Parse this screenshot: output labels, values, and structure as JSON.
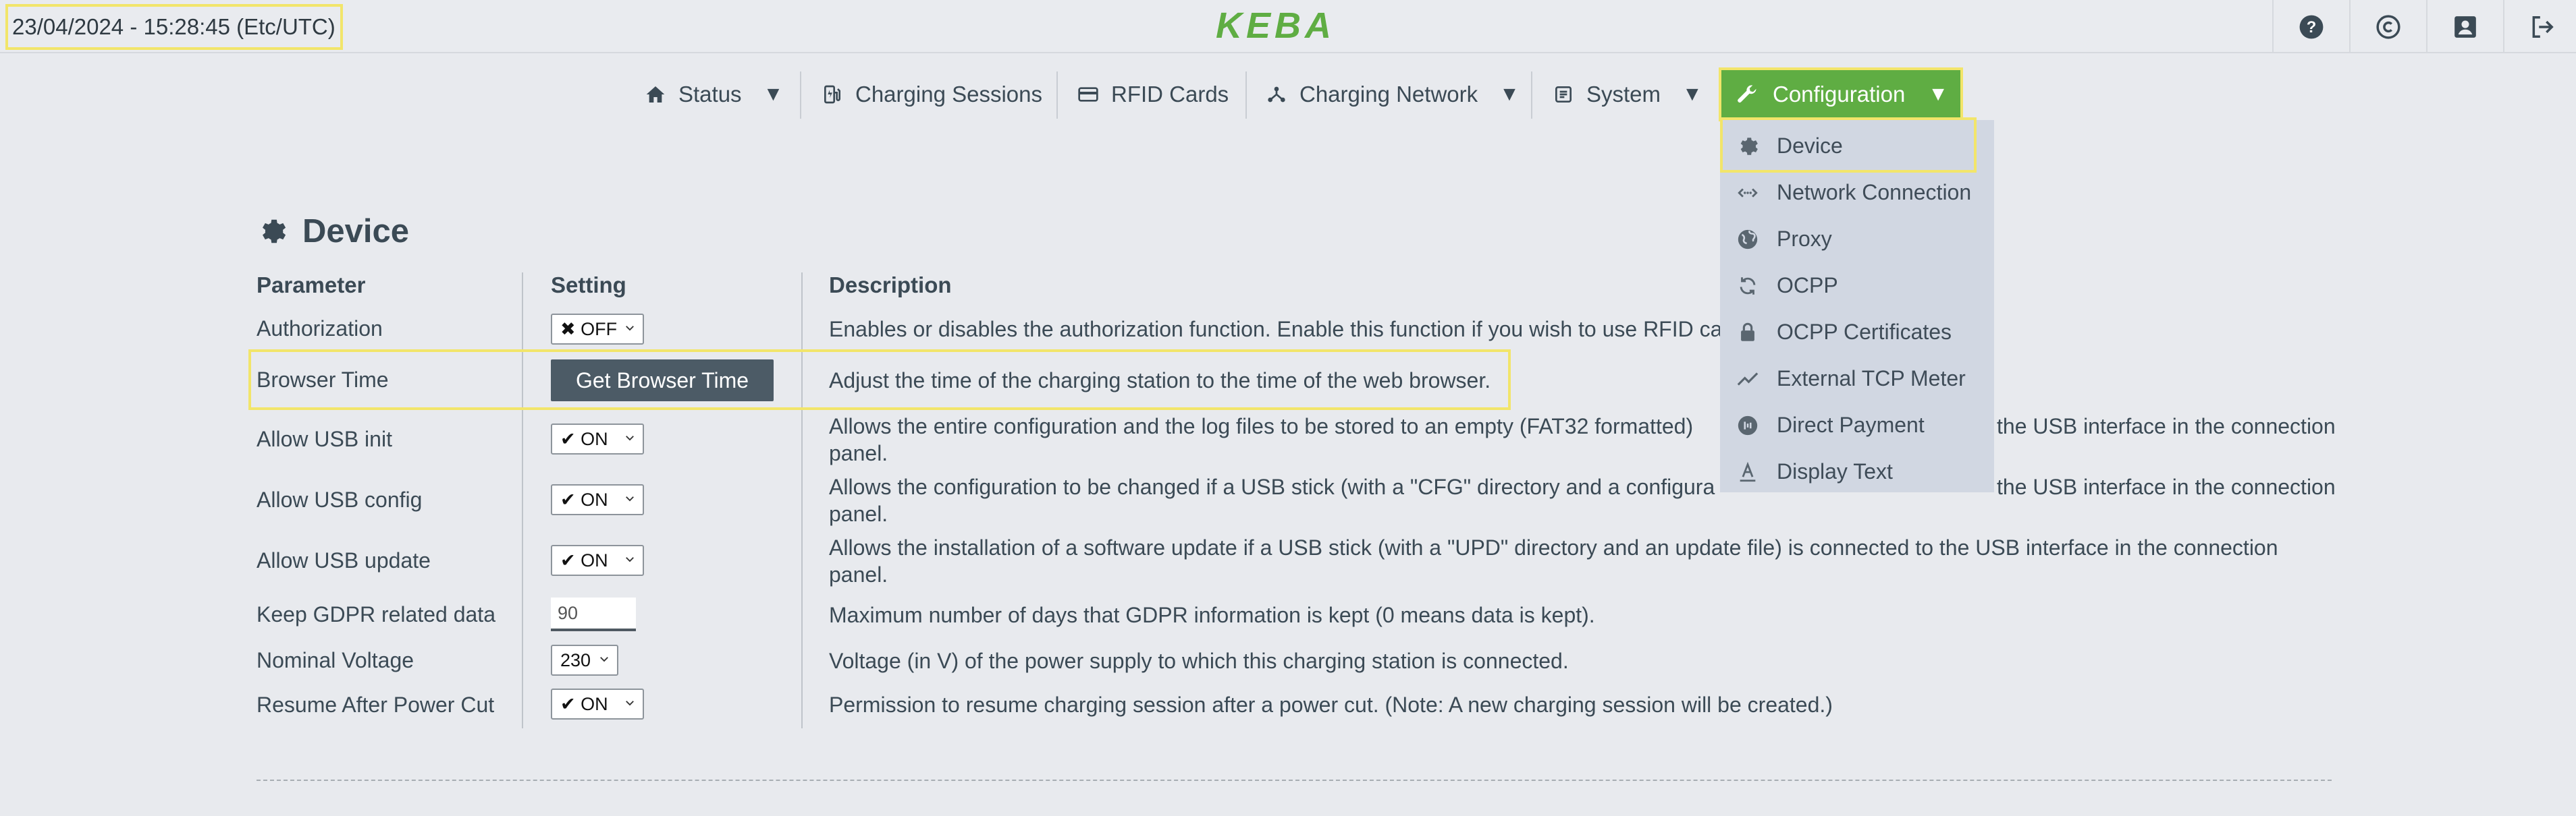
{
  "header": {
    "datetime": "23/04/2024 - 15:28:45 (Etc/UTC)",
    "logo_text": "KEBA",
    "icons": [
      "help-icon",
      "copyright-icon",
      "account-icon",
      "logout-icon"
    ]
  },
  "nav": {
    "status": "Status",
    "charging_sessions": "Charging Sessions",
    "rfid_cards": "RFID Cards",
    "charging_network": "Charging Network",
    "system": "System",
    "configuration": "Configuration",
    "caret": "▼"
  },
  "dropdown": {
    "items": [
      {
        "label": "Device",
        "icon": "gear-icon"
      },
      {
        "label": "Network Connection",
        "icon": "network-icon"
      },
      {
        "label": "Proxy",
        "icon": "globe-icon"
      },
      {
        "label": "OCPP",
        "icon": "sync-icon"
      },
      {
        "label": "OCPP Certificates",
        "icon": "lock-icon"
      },
      {
        "label": "External TCP Meter",
        "icon": "trend-icon"
      },
      {
        "label": "Direct Payment",
        "icon": "payment-icon"
      },
      {
        "label": "Display Text",
        "icon": "text-icon"
      }
    ]
  },
  "page": {
    "title": "Device",
    "headers": {
      "parameter": "Parameter",
      "setting": "Setting",
      "description": "Description"
    },
    "rows": [
      {
        "param": "Authorization",
        "setting": "✖ OFF",
        "desc": "Enables or disables the authorization function. Enable this function if you wish to use RFID ca"
      },
      {
        "param": "Browser Time",
        "setting": "Get Browser Time",
        "desc": "Adjust the time of the charging station to the time of the web browser."
      },
      {
        "param": "Allow USB init",
        "setting": "✔ ON",
        "desc": "Allows the entire configuration and the log files to be stored to an empty (FAT32 formatted)",
        "desc_tail": "the USB interface in the connection",
        "desc2": "panel."
      },
      {
        "param": "Allow USB config",
        "setting": "✔ ON",
        "desc": "Allows the configuration to be changed if a USB stick (with a \"CFG\" directory and a configura",
        "desc_tail": "the USB interface in the connection",
        "desc2": "panel."
      },
      {
        "param": "Allow USB update",
        "setting": "✔ ON",
        "desc": "Allows the installation of a software update if a USB stick (with a \"UPD\" directory and an update file) is connected to the USB interface in the connection",
        "desc2": "panel."
      },
      {
        "param": "Keep GDPR related data",
        "setting": "90",
        "desc": "Maximum number of days that GDPR information is kept (0 means data is kept)."
      },
      {
        "param": "Nominal Voltage",
        "setting": "230",
        "desc": "Voltage (in V) of the power supply to which this charging station is connected."
      },
      {
        "param": "Resume After Power Cut",
        "setting": "✔ ON",
        "desc": "Permission to resume charging session after a power cut. (Note: A new charging session will be created.)"
      }
    ]
  },
  "colors": {
    "accent": "#5fad43",
    "highlight": "#f2e56a",
    "button": "#4c5b66",
    "dropdown_bg": "#d1d7e2"
  }
}
